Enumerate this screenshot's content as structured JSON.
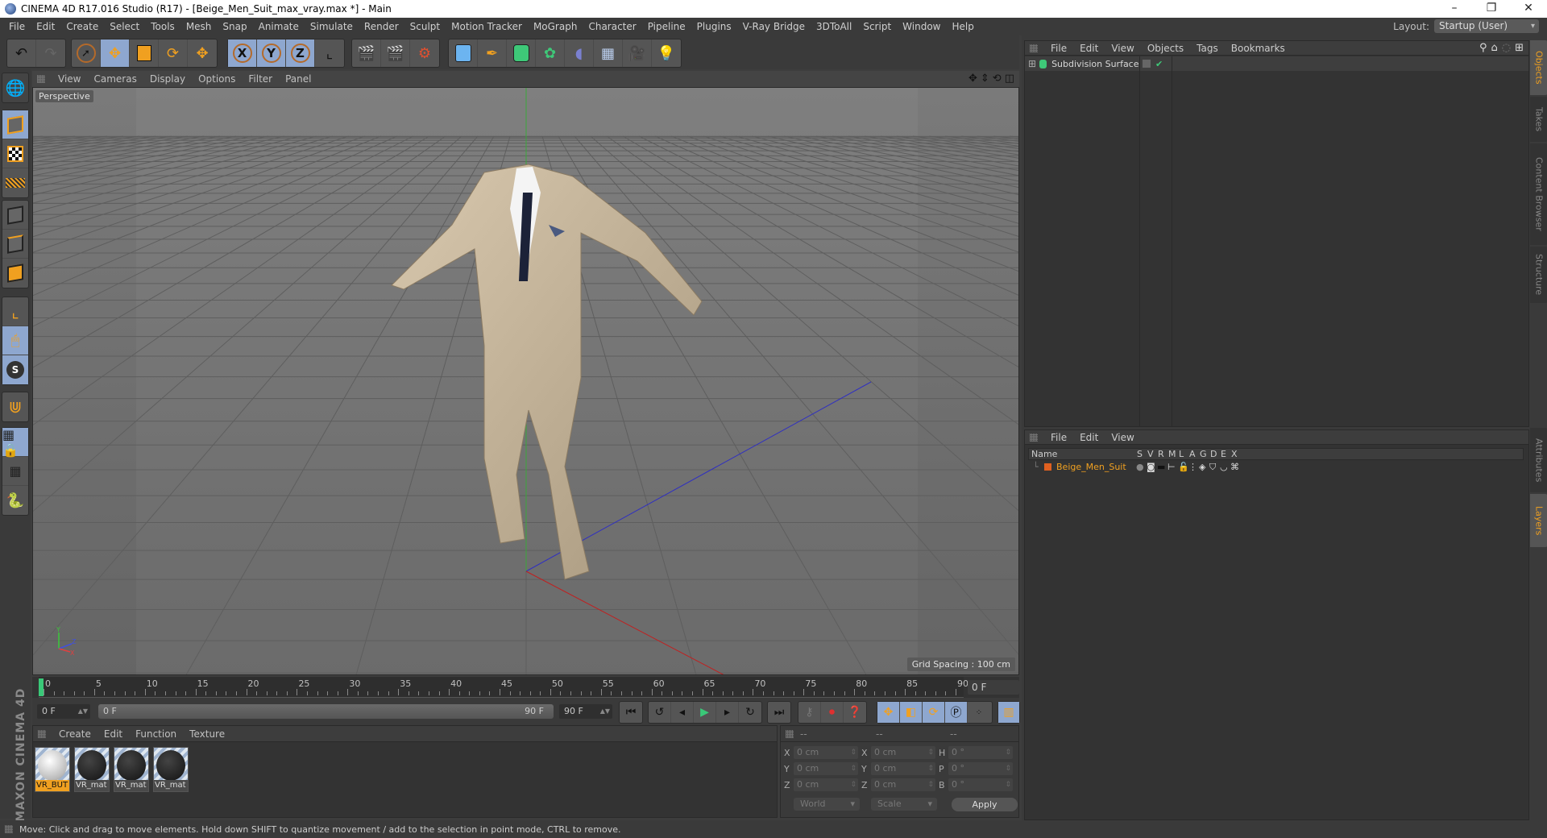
{
  "window": {
    "title": "CINEMA 4D R17.016 Studio (R17) - [Beige_Men_Suit_max_vray.max *] - Main",
    "controls": [
      "–",
      "❐",
      "✕"
    ]
  },
  "menubar": {
    "items": [
      "File",
      "Edit",
      "Create",
      "Select",
      "Tools",
      "Mesh",
      "Snap",
      "Animate",
      "Simulate",
      "Render",
      "Sculpt",
      "Motion Tracker",
      "MoGraph",
      "Character",
      "Pipeline",
      "Plugins",
      "V-Ray Bridge",
      "3DToAll",
      "Script",
      "Window",
      "Help"
    ],
    "layout_label": "Layout:",
    "layout_value": "Startup (User)"
  },
  "toolbar": {
    "undo": "undo-icon",
    "redo": "redo-icon",
    "tools": [
      "live-selection-icon",
      "move-icon",
      "scale-icon",
      "rotate-icon",
      "move-last-icon"
    ],
    "axes": [
      "X",
      "Y",
      "Z"
    ],
    "coord_system": "world-coordinate-icon",
    "render": [
      "render-view-icon",
      "render-picture-viewer-icon",
      "render-settings-icon"
    ],
    "create": [
      "cube-icon",
      "pen-spline-icon",
      "subdivision-surface-icon",
      "array-icon",
      "deformer-icon",
      "floor-icon",
      "camera-icon",
      "light-icon"
    ]
  },
  "viewport": {
    "menu": [
      "View",
      "Cameras",
      "Display",
      "Options",
      "Filter",
      "Panel"
    ],
    "label": "Perspective",
    "grid_spacing": "Grid Spacing : 100 cm",
    "axis_labels": [
      "Y",
      "Z",
      "X"
    ]
  },
  "timeline": {
    "ticks": [
      "0",
      "5",
      "10",
      "15",
      "20",
      "25",
      "30",
      "35",
      "40",
      "45",
      "50",
      "55",
      "60",
      "65",
      "70",
      "75",
      "80",
      "85",
      "90"
    ],
    "current_frame": "0 F",
    "start_field": "0 F",
    "range_start": "0 F",
    "range_end": "90 F",
    "end_field": "90 F"
  },
  "materials": {
    "menu": [
      "Create",
      "Edit",
      "Function",
      "Texture"
    ],
    "items": [
      {
        "label": "VR_BUT",
        "selected": true,
        "style": "white"
      },
      {
        "label": "VR_mat",
        "selected": false,
        "style": "dark"
      },
      {
        "label": "VR_mat",
        "selected": false,
        "style": "dark"
      },
      {
        "label": "VR_mat",
        "selected": false,
        "style": "dark"
      }
    ]
  },
  "coordinates": {
    "headers": [
      "--",
      "--",
      "--"
    ],
    "rows": [
      {
        "l1": "X",
        "v1": "0 cm",
        "l2": "X",
        "v2": "0 cm",
        "l3": "H",
        "v3": "0 °"
      },
      {
        "l1": "Y",
        "v1": "0 cm",
        "l2": "Y",
        "v2": "0 cm",
        "l3": "P",
        "v3": "0 °"
      },
      {
        "l1": "Z",
        "v1": "0 cm",
        "l2": "Z",
        "v2": "0 cm",
        "l3": "B",
        "v3": "0 °"
      }
    ],
    "mode": "World",
    "type": "Scale",
    "apply": "Apply"
  },
  "status": {
    "text": "Move: Click and drag to move elements. Hold down SHIFT to quantize movement / add to the selection in point mode, CTRL to remove."
  },
  "objects": {
    "menu": [
      "File",
      "Edit",
      "View",
      "Objects",
      "Tags",
      "Bookmarks"
    ],
    "items": [
      {
        "name": "Subdivision Surface"
      }
    ]
  },
  "layers": {
    "menu": [
      "File",
      "Edit",
      "View"
    ],
    "columns": [
      "Name",
      "S",
      "V",
      "R",
      "M",
      "L",
      "A",
      "G",
      "D",
      "E",
      "X"
    ],
    "items": [
      {
        "name": "Beige_Men_Suit",
        "color": "#e06020"
      }
    ]
  },
  "side_tabs": {
    "top": [
      "Objects",
      "Takes",
      "Content Browser",
      "Structure"
    ],
    "bottom": [
      "Attributes",
      "Layers"
    ]
  },
  "branding": "MAXON CINEMA 4D",
  "colors": {
    "accent": "#f0a020",
    "active_button": "#8ea7cf",
    "playhead": "#3ac878"
  }
}
